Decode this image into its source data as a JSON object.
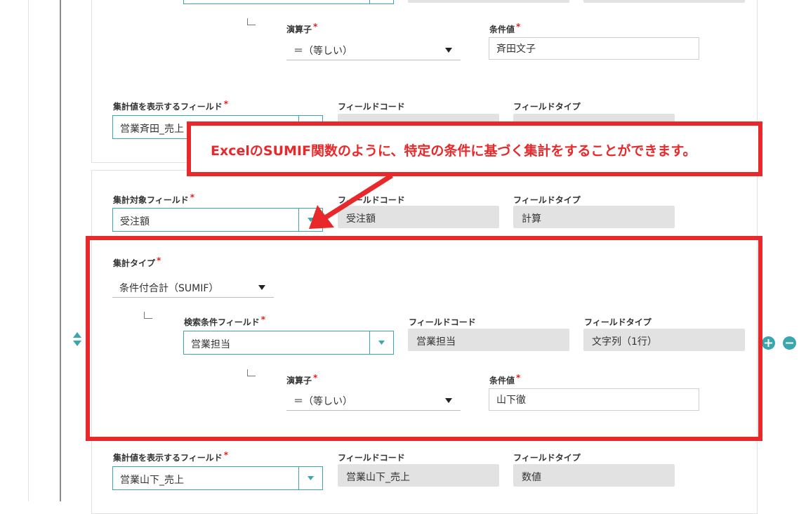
{
  "callout": {
    "text": "ExcelのSUMIF関数のように、特定の条件に基づく集計をすることができます。"
  },
  "group1": {
    "operator": {
      "label": "演算子",
      "value": "＝（等しい）"
    },
    "condition_value": {
      "label": "条件値",
      "value": "斉田文子"
    },
    "display_field": {
      "label": "集計値を表示するフィールド",
      "value": "営業斉田_売上"
    },
    "field_code_label": "フィールドコード",
    "field_type_label": "フィールドタイプ"
  },
  "group2": {
    "target_field": {
      "label": "集計対象フィールド",
      "value": "受注額"
    },
    "target_field_code": {
      "label": "フィールドコード",
      "value": "受注額"
    },
    "target_field_type": {
      "label": "フィールドタイプ",
      "value": "計算"
    },
    "aggregate_type": {
      "label": "集計タイプ",
      "value": "条件付合計（SUMIF）"
    },
    "search_field": {
      "label": "検索条件フィールド",
      "value": "営業担当"
    },
    "search_field_code": {
      "label": "フィールドコード",
      "value": "営業担当"
    },
    "search_field_type": {
      "label": "フィールドタイプ",
      "value": "文字列（1行）"
    },
    "operator": {
      "label": "演算子",
      "value": "＝（等しい）"
    },
    "condition_value": {
      "label": "条件値",
      "value": "山下徹"
    },
    "display_field": {
      "label": "集計値を表示するフィールド",
      "value": "営業山下_売上"
    },
    "display_field_code": {
      "label": "フィールドコード",
      "value": "営業山下_売上"
    },
    "display_field_type": {
      "label": "フィールドタイプ",
      "value": "数値"
    }
  },
  "required_mark": "*",
  "colors": {
    "accent": "#3aa6b0",
    "highlight": "#e8282b",
    "required": "#e02020"
  }
}
